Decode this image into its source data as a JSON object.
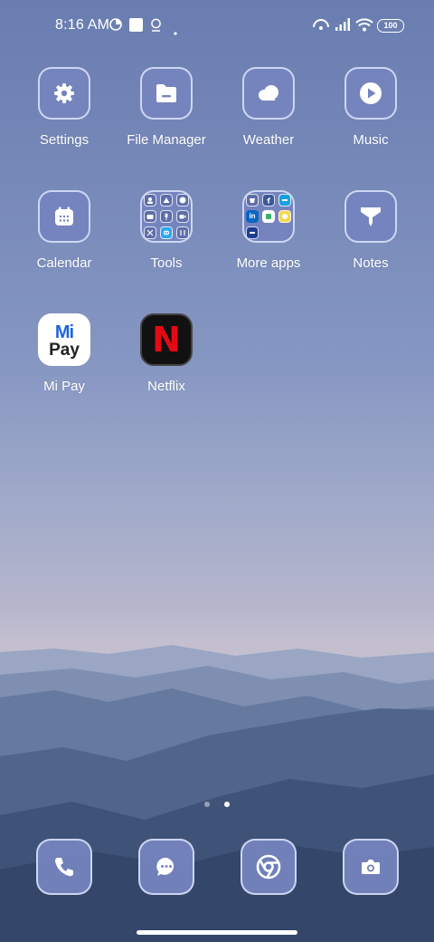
{
  "status_bar": {
    "time": "8:16 AM",
    "battery": "100"
  },
  "apps": {
    "settings": "Settings",
    "file_manager": "File Manager",
    "weather": "Weather",
    "music": "Music",
    "calendar": "Calendar",
    "tools": "Tools",
    "more_apps": "More apps",
    "notes": "Notes",
    "mi_pay": "Mi Pay",
    "netflix": "Netflix"
  },
  "app_icons": {
    "mi_pay_logo_mi": "Mi",
    "mi_pay_logo_pay": "Pay",
    "netflix_logo": "N"
  },
  "page_indicator": {
    "pages": 2,
    "current": 2
  },
  "dock": [
    "phone",
    "messages",
    "chrome",
    "camera"
  ],
  "colors": {
    "tile_bg": "#7584be",
    "tile_border": "#dee4fa",
    "netflix_red": "#e50914"
  }
}
